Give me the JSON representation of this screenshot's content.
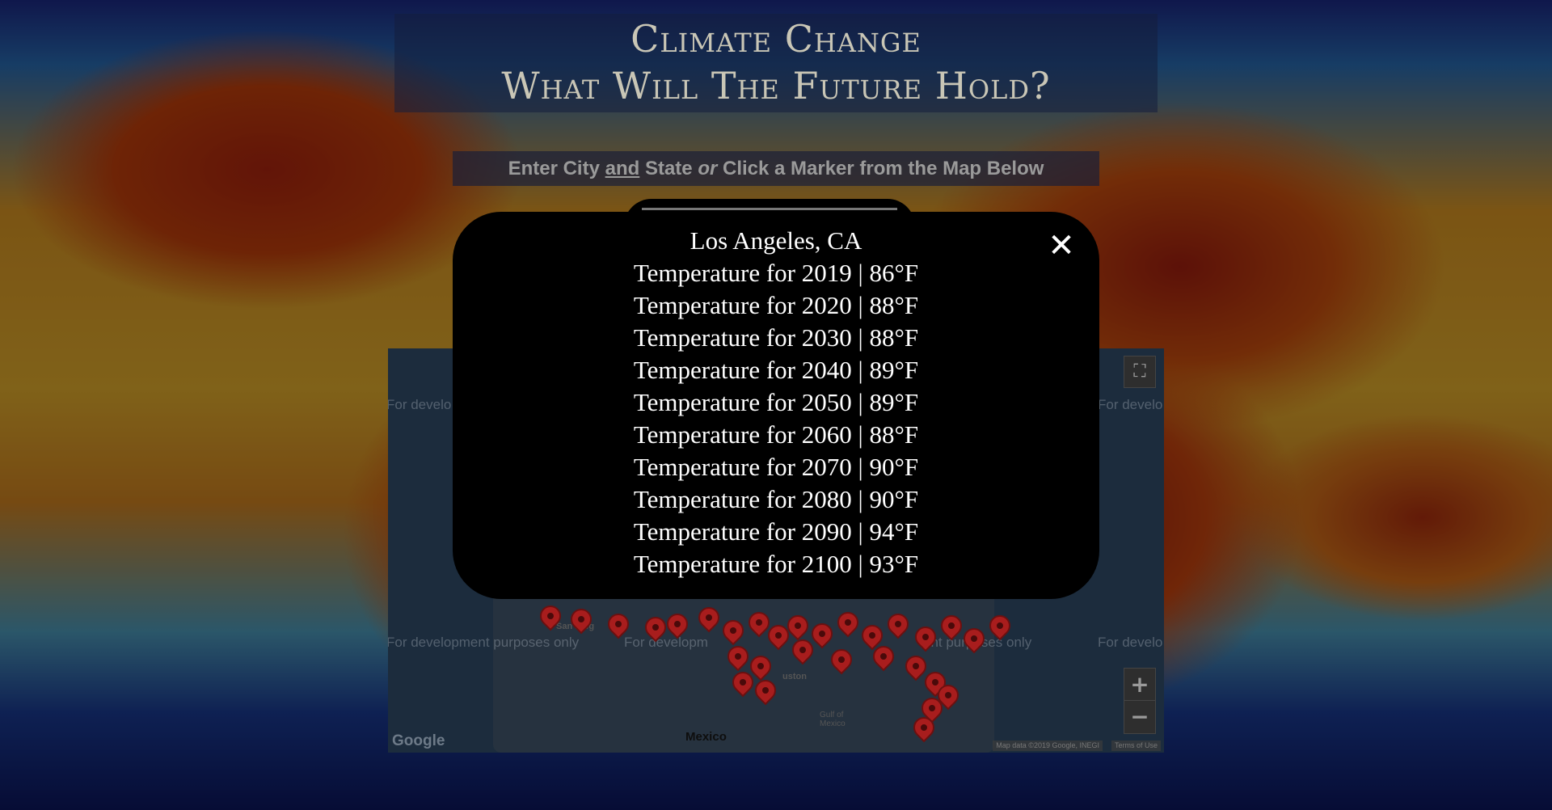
{
  "header": {
    "title_line1": "Climate Change",
    "title_line2": "What Will The Future Hold?"
  },
  "prompt": {
    "part1": "Enter City ",
    "and": "and",
    "part2": " State ",
    "or": "or",
    "part3": " Click a Marker from the Map Below"
  },
  "map": {
    "watermark": "For development purposes only",
    "watermark_short": "For develo",
    "watermark_mid": "For developm",
    "watermark_tail": "ent purposes only",
    "label_mexico": "Mexico",
    "label_san_diego": "San Dieg",
    "label_houston": "uston",
    "label_gulf": "Gulf of Mexico",
    "logo_text": "Google",
    "attribution": "Map data ©2019 Google, INEGI",
    "terms": "Terms of Use",
    "fullscreen_icon": "⛶",
    "zoom_in": "+",
    "zoom_out": "−"
  },
  "modal": {
    "city": "Los Angeles, CA",
    "close_symbol": "✕",
    "rows": [
      "Temperature for 2019 | 86°F",
      "Temperature for 2020 | 88°F",
      "Temperature for 2030 | 88°F",
      "Temperature for 2040 | 89°F",
      "Temperature for 2050 | 89°F",
      "Temperature for 2060 | 88°F",
      "Temperature for 2070 | 90°F",
      "Temperature for 2080 | 90°F",
      "Temperature for 2090 | 94°F",
      "Temperature for 2100 | 93°F"
    ]
  },
  "colors": {
    "modal_bg": "#000000",
    "marker": "#a81d1d",
    "title_text": "#c9c6b6"
  }
}
